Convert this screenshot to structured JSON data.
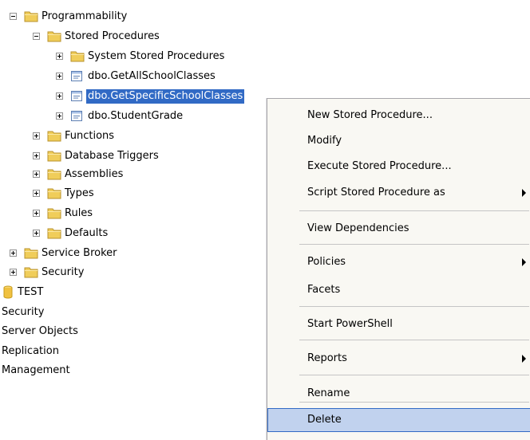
{
  "tree": {
    "items": [
      {
        "label": "Programmability",
        "toggle": "minus",
        "icon": "folder"
      },
      {
        "label": "Stored Procedures",
        "toggle": "minus",
        "icon": "folder"
      },
      {
        "label": "System Stored Procedures",
        "toggle": "plus",
        "icon": "folder"
      },
      {
        "label": "dbo.GetAllSchoolClasses",
        "toggle": "plus",
        "icon": "stored-procedure"
      },
      {
        "label": "dbo.GetSpecificSchoolClasses",
        "toggle": "plus",
        "icon": "stored-procedure",
        "selected": true
      },
      {
        "label": "dbo.StudentGrade",
        "toggle": "plus",
        "icon": "stored-procedure"
      },
      {
        "label": "Functions",
        "toggle": "plus",
        "icon": "folder"
      },
      {
        "label": "Database Triggers",
        "toggle": "plus",
        "icon": "folder"
      },
      {
        "label": "Assemblies",
        "toggle": "plus",
        "icon": "folder"
      },
      {
        "label": "Types",
        "toggle": "plus",
        "icon": "folder"
      },
      {
        "label": "Rules",
        "toggle": "plus",
        "icon": "folder"
      },
      {
        "label": "Defaults",
        "toggle": "plus",
        "icon": "folder"
      },
      {
        "label": "Service Broker",
        "toggle": "plus",
        "icon": "folder"
      },
      {
        "label": "Security",
        "toggle": "plus",
        "icon": "folder"
      },
      {
        "label": "TEST",
        "toggle": "none",
        "icon": "database"
      },
      {
        "label": "Security",
        "toggle": "none",
        "icon": "none"
      },
      {
        "label": "Server Objects",
        "toggle": "none",
        "icon": "none"
      },
      {
        "label": "Replication",
        "toggle": "none",
        "icon": "none"
      },
      {
        "label": "Management",
        "toggle": "none",
        "icon": "none"
      }
    ]
  },
  "context_menu": {
    "items": [
      {
        "label": "New Stored Procedure...",
        "submenu": false
      },
      {
        "label": "Modify",
        "submenu": false
      },
      {
        "label": "Execute Stored Procedure...",
        "submenu": false
      },
      {
        "label": "Script Stored Procedure as",
        "submenu": true
      },
      {
        "label": "View Dependencies",
        "submenu": false
      },
      {
        "label": "Policies",
        "submenu": true
      },
      {
        "label": "Facets",
        "submenu": false
      },
      {
        "label": "Start PowerShell",
        "submenu": false
      },
      {
        "label": "Reports",
        "submenu": true
      },
      {
        "label": "Rename",
        "submenu": false
      },
      {
        "label": "Delete",
        "submenu": false,
        "highlighted": true
      }
    ]
  },
  "colors": {
    "selection": "#316ac5",
    "menu_highlight": "#c1d2ee",
    "menu_background": "#f9f8f3",
    "folder": "#f0cd5a"
  }
}
